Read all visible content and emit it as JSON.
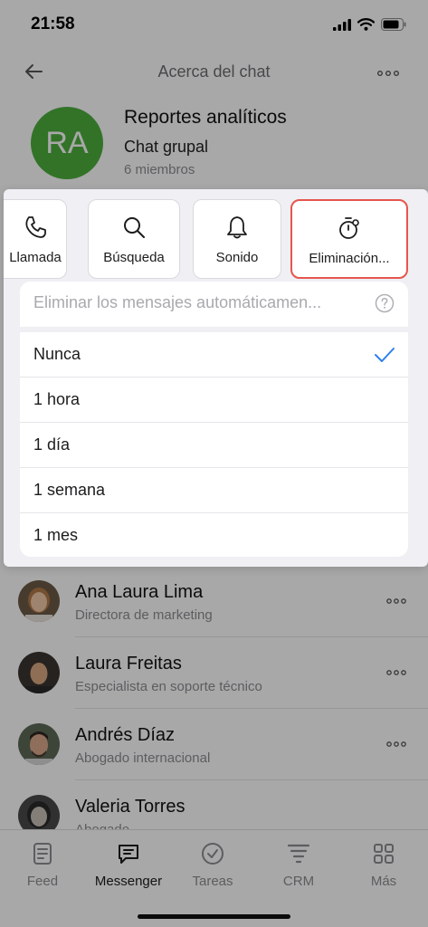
{
  "status_bar": {
    "time": "21:58"
  },
  "header": {
    "title": "Acerca del chat"
  },
  "chat": {
    "avatar_initials": "RA",
    "avatar_color": "#4caf3e",
    "name": "Reportes analíticos",
    "type": "Chat grupal",
    "members_count": "6 miembros"
  },
  "actions": [
    {
      "label": "Llamada",
      "icon": "phone-icon"
    },
    {
      "label": "Búsqueda",
      "icon": "search-icon"
    },
    {
      "label": "Sonido",
      "icon": "bell-icon"
    },
    {
      "label": "Eliminación...",
      "icon": "timer-icon"
    }
  ],
  "auto_delete": {
    "placeholder": "Eliminar los mensajes automáticamen...",
    "options": [
      {
        "label": "Nunca",
        "selected": true
      },
      {
        "label": "1 hora",
        "selected": false
      },
      {
        "label": "1 día",
        "selected": false
      },
      {
        "label": "1 semana",
        "selected": false
      },
      {
        "label": "1 mes",
        "selected": false
      }
    ]
  },
  "members": [
    {
      "name": "Ana Laura Lima",
      "role": "Directora de marketing"
    },
    {
      "name": "Laura Freitas",
      "role": "Especialista en soporte técnico"
    },
    {
      "name": "Andrés Díaz",
      "role": "Abogado internacional"
    },
    {
      "name": "Valeria Torres",
      "role": "Abogado"
    }
  ],
  "tab_bar": {
    "items": [
      {
        "label": "Feed",
        "icon": "feed-icon"
      },
      {
        "label": "Messenger",
        "icon": "messenger-icon",
        "active": true
      },
      {
        "label": "Tareas",
        "icon": "tasks-icon"
      },
      {
        "label": "CRM",
        "icon": "crm-icon"
      },
      {
        "label": "Más",
        "icon": "more-grid-icon"
      }
    ]
  },
  "colors": {
    "accent": "#2f80ed",
    "highlight_border": "#e5564d",
    "avatar_green": "#4caf3e"
  }
}
